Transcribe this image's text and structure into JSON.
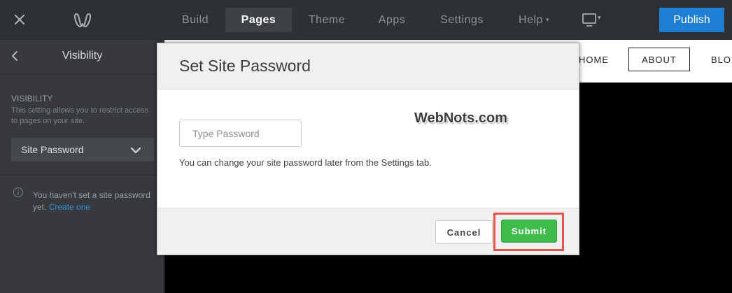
{
  "topbar": {
    "close_icon": "close-icon",
    "logo_icon": "weebly-logo-icon",
    "nav": [
      {
        "label": "Build",
        "active": false
      },
      {
        "label": "Pages",
        "active": true
      },
      {
        "label": "Theme",
        "active": false
      },
      {
        "label": "Apps",
        "active": false
      },
      {
        "label": "Settings",
        "active": false
      },
      {
        "label": "Help",
        "active": false
      }
    ],
    "help_caret": "▾",
    "device_caret": "▾",
    "publish_label": "Publish",
    "accent_color": "#1f7fd4"
  },
  "sidebar": {
    "title": "Visibility",
    "section_heading": "VISIBILITY",
    "description": "This setting allows you to restrict access to pages on your site.",
    "select_value": "Site Password",
    "notice_text": "You haven't set a site password yet.",
    "notice_link": "Create one"
  },
  "preview": {
    "nav_home": "HOME",
    "nav_about": "ABOUT",
    "nav_blog": "BLO"
  },
  "modal": {
    "title": "Set Site Password",
    "input_placeholder": "Type Password",
    "input_value": "",
    "help_text": "You can change your site password later from the Settings tab.",
    "watermark": "WebNots.com",
    "cancel_label": "Cancel",
    "submit_label": "Submit",
    "submit_color": "#3fbd4b",
    "highlight_color": "#e8524a"
  }
}
